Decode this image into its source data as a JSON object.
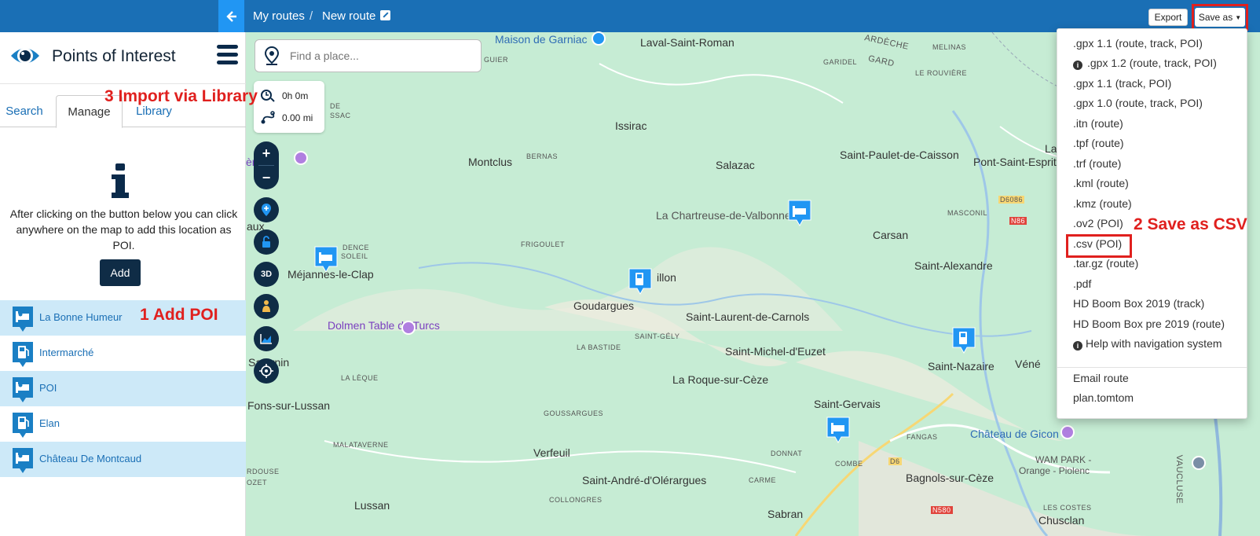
{
  "header": {
    "breadcrumb_root": "My routes",
    "breadcrumb_separator": "/",
    "breadcrumb_current": "New route",
    "export_label": "Export",
    "save_as_label": "Save as"
  },
  "sidebar": {
    "title": "Points of Interest",
    "tabs": [
      {
        "label": "Search",
        "active": false
      },
      {
        "label": "Manage",
        "active": true
      },
      {
        "label": "Library",
        "active": false
      }
    ],
    "info_text": "After clicking on the button below you can click anywhere on the map to add this location as POI.",
    "add_button": "Add",
    "poi_items": [
      {
        "label": "La Bonne Humeur",
        "icon": "bed-icon"
      },
      {
        "label": "Intermarché",
        "icon": "fuel-icon"
      },
      {
        "label": "POI",
        "icon": "bed-icon"
      },
      {
        "label": "Elan",
        "icon": "fuel-icon"
      },
      {
        "label": "Château De Montcaud",
        "icon": "bed-icon"
      }
    ]
  },
  "map": {
    "search_placeholder": "Find a place...",
    "duration": "0h 0m",
    "distance": "0.00 mi",
    "btn_3d": "3D",
    "labels": [
      {
        "text": "Maison de Garniac",
        "style": "blue"
      },
      {
        "text": "Laval-Saint-Roman",
        "style": ""
      },
      {
        "text": "ARDÈCHE",
        "style": "sm"
      },
      {
        "text": "GARD",
        "style": "sm"
      },
      {
        "text": "MELINAS",
        "style": "sm"
      },
      {
        "text": "GARIDEL",
        "style": "sm"
      },
      {
        "text": "LE ROUVIÈRE",
        "style": "sm"
      },
      {
        "text": "GUIER",
        "style": "sm"
      },
      {
        "text": "Issirac",
        "style": ""
      },
      {
        "text": "BERNAS",
        "style": "sm"
      },
      {
        "text": "Montclus",
        "style": ""
      },
      {
        "text": "Salazac",
        "style": ""
      },
      {
        "text": "Saint-Paulet-de-Caisson",
        "style": ""
      },
      {
        "text": "Pont-Saint-Esprit",
        "style": ""
      },
      {
        "text": "La Chartreuse-de-Valbonne",
        "style": ""
      },
      {
        "text": "MASCONIL",
        "style": "sm"
      },
      {
        "text": "Carsan",
        "style": ""
      },
      {
        "text": "FRIGOULET",
        "style": "sm"
      },
      {
        "text": "Saint-Alexandre",
        "style": ""
      },
      {
        "text": "Méjannes-le-Clap",
        "style": ""
      },
      {
        "text": "illon",
        "style": ""
      },
      {
        "text": "Goudargues",
        "style": ""
      },
      {
        "text": "Saint-Laurent-de-Carnols",
        "style": ""
      },
      {
        "text": "Dolmen Table de Turcs",
        "style": "purple"
      },
      {
        "text": "SAINT-GÉLY",
        "style": "sm"
      },
      {
        "text": "LA BASTIDE",
        "style": "sm"
      },
      {
        "text": "Saint-Michel-d'Euzet",
        "style": ""
      },
      {
        "text": "Saint-Nazaire",
        "style": ""
      },
      {
        "text": "Véné",
        "style": ""
      },
      {
        "text": "LA LÈQUE",
        "style": "sm"
      },
      {
        "text": "La Roque-sur-Cèze",
        "style": ""
      },
      {
        "text": "Fons-sur-Lussan",
        "style": ""
      },
      {
        "text": "Saint-Gervais",
        "style": ""
      },
      {
        "text": "GOUSSARGUES",
        "style": "sm"
      },
      {
        "text": "FANGAS",
        "style": "sm"
      },
      {
        "text": "Château de Gicon",
        "style": "blue"
      },
      {
        "text": "MALATAVERNE",
        "style": "sm"
      },
      {
        "text": "Verfeuil",
        "style": ""
      },
      {
        "text": "DONNAT",
        "style": "sm"
      },
      {
        "text": "COMBE",
        "style": "sm"
      },
      {
        "text": "WAM PARK -",
        "style": ""
      },
      {
        "text": "Orange - Piolenc",
        "style": ""
      },
      {
        "text": "Saint-André-d'Olérargues",
        "style": ""
      },
      {
        "text": "CARME",
        "style": "sm"
      },
      {
        "text": "Bagnols-sur-Cèze",
        "style": ""
      },
      {
        "text": "COLLONGRES",
        "style": "sm"
      },
      {
        "text": "Lussan",
        "style": ""
      },
      {
        "text": "Sabran",
        "style": ""
      },
      {
        "text": "LES COSTES",
        "style": "sm"
      },
      {
        "text": "Chusclan",
        "style": ""
      },
      {
        "text": "VAUCLUSE",
        "style": "sm"
      },
      {
        "text": "D6086",
        "style": "sm"
      },
      {
        "text": "N86",
        "style": "sm"
      },
      {
        "text": "D6",
        "style": "sm"
      },
      {
        "text": "N580",
        "style": "sm"
      },
      {
        "text": "Saturnin",
        "style": ""
      },
      {
        "text": "aux",
        "style": ""
      },
      {
        "text": "Lar",
        "style": ""
      },
      {
        "text": "DE",
        "style": "sm"
      },
      {
        "text": "SSAC",
        "style": "sm"
      },
      {
        "text": "RDOUSE",
        "style": "sm"
      },
      {
        "text": "OZET",
        "style": "sm"
      },
      {
        "text": "DENCE",
        "style": "sm"
      },
      {
        "text": "SOLEIL",
        "style": "sm"
      },
      {
        "text": "ère",
        "style": "purple"
      }
    ]
  },
  "save_menu": {
    "items": [
      {
        "label": ".gpx 1.1 (route, track, POI)",
        "info": false
      },
      {
        "label": ".gpx 1.2 (route, track, POI)",
        "info": true
      },
      {
        "label": ".gpx 1.1 (track, POI)",
        "info": false
      },
      {
        "label": ".gpx 1.0 (route, track, POI)",
        "info": false
      },
      {
        "label": ".itn (route)",
        "info": false
      },
      {
        "label": ".tpf (route)",
        "info": false
      },
      {
        "label": ".trf (route)",
        "info": false
      },
      {
        "label": ".kml (route)",
        "info": false
      },
      {
        "label": ".kmz (route)",
        "info": false
      },
      {
        "label": ".ov2 (POI)",
        "info": false
      },
      {
        "label": ".csv (POI)",
        "info": false
      },
      {
        "label": ".tar.gz (route)",
        "info": false
      },
      {
        "label": ".pdf",
        "info": false
      },
      {
        "label": "HD Boom Box 2019 (track)",
        "info": false
      },
      {
        "label": "HD Boom Box pre 2019 (route)",
        "info": false
      },
      {
        "label": "Help with navigation system",
        "info": true
      }
    ],
    "extra_items": [
      "Email route",
      "plan.tomtom"
    ]
  },
  "annotations": {
    "step1": "1 Add POI",
    "step2": "2 Save as CSV",
    "step3": "3 Import via Library"
  },
  "colors": {
    "topbar": "#1a6fb5",
    "accent": "#2196f3",
    "dark_button": "#0f2c46",
    "highlight_red": "#e0201e",
    "map_green": "#c6ecd4",
    "poi_row_blue": "#cde9f8"
  }
}
